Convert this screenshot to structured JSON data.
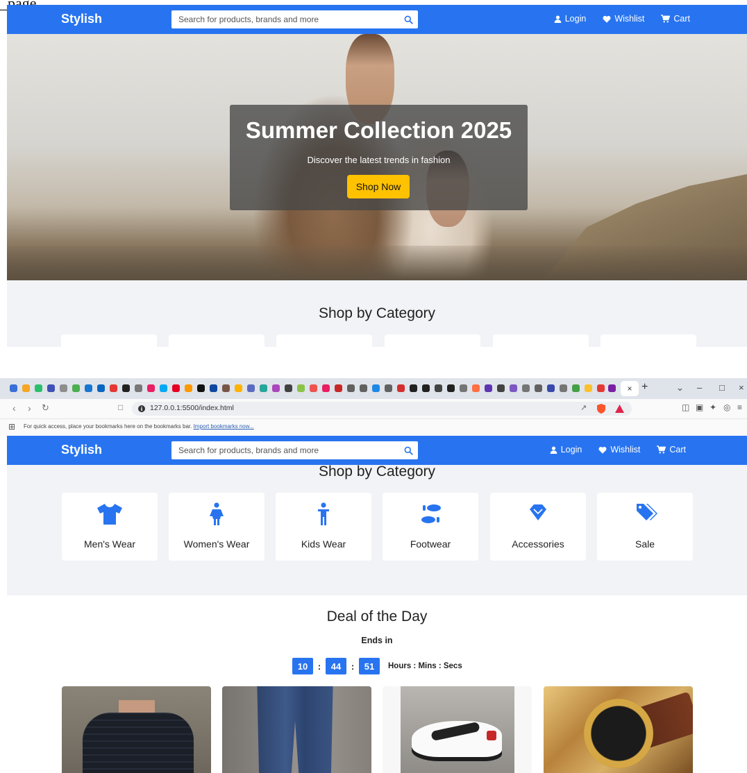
{
  "top_cut_text": "_page",
  "navbar": {
    "brand": "Stylish",
    "search_placeholder": "Search for products, brands and more",
    "login": "Login",
    "wishlist": "Wishlist",
    "cart": "Cart"
  },
  "hero": {
    "title": "Summer Collection 2025",
    "subtitle": "Discover the latest trends in fashion",
    "cta": "Shop Now"
  },
  "browser": {
    "tab_close": "×",
    "tab_new": "+",
    "url": "127.0.0.1:5500/index.html",
    "bookmarks_text": "For quick access, place your bookmarks here on the bookmarks bar.",
    "bookmarks_link": "Import bookmarks now..."
  },
  "categories": {
    "heading": "Shop by Category",
    "items": [
      {
        "label": "Men's Wear",
        "icon": "tshirt-icon"
      },
      {
        "label": "Women's Wear",
        "icon": "person-icon"
      },
      {
        "label": "Kids Wear",
        "icon": "child-icon"
      },
      {
        "label": "Footwear",
        "icon": "shoe-prints-icon"
      },
      {
        "label": "Accessories",
        "icon": "gem-icon"
      },
      {
        "label": "Sale",
        "icon": "tags-icon"
      }
    ]
  },
  "deal": {
    "title": "Deal of the Day",
    "ends_in": "Ends in",
    "hours": "10",
    "mins": "44",
    "secs": "51",
    "separator": ":",
    "units": "Hours : Mins : Secs"
  },
  "products": [
    {
      "icon": "shirt-image"
    },
    {
      "icon": "jeans-image"
    },
    {
      "icon": "sneaker-image"
    },
    {
      "icon": "watch-image"
    }
  ],
  "colors": {
    "primary": "#2874f0",
    "accent": "#ffc200",
    "band": "#f1f3f6"
  }
}
